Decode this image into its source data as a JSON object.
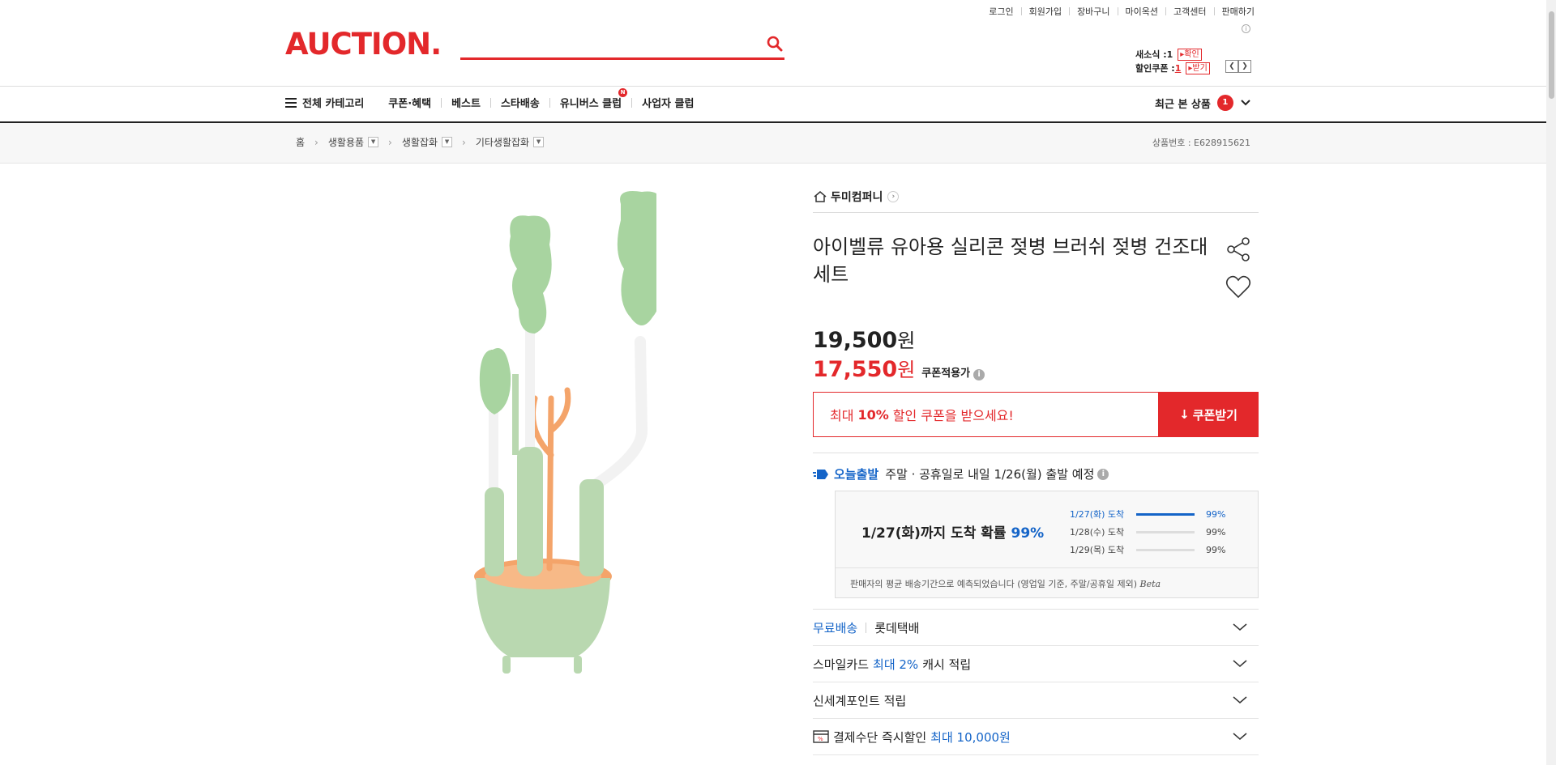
{
  "util_links": [
    "로그인",
    "회원가입",
    "장바구니",
    "마이옥션",
    "고객센터",
    "판매하기"
  ],
  "logo": "AUCTION.",
  "search": {
    "placeholder": "",
    "value": ""
  },
  "mini": {
    "news_label": "새소식 :",
    "news_count": "1",
    "news_btn": "확인",
    "coupon_label": "할인쿠폰 :",
    "coupon_count": "1",
    "coupon_btn": "받기"
  },
  "nav": {
    "all_category": "전체 카테고리",
    "items": [
      "쿠폰·혜택",
      "베스트",
      "스타배송",
      "유니버스 클럽",
      "사업자 클럽"
    ],
    "new_badge": "N",
    "recent_label": "최근 본 상품",
    "recent_count": "1"
  },
  "breadcrumb": [
    "홈",
    "생활용품",
    "생활잡화",
    "기타생활잡화"
  ],
  "product_no": "상품번호 : E628915621",
  "store": "두미컴퍼니",
  "title": "아이벨류 유아용 실리콘 젖병 브러쉬 젖병 건조대 세트",
  "price": {
    "original": "19,500",
    "won": "원",
    "coupon": "17,550",
    "coupon_label": "쿠폰적용가"
  },
  "coupon": {
    "prefix": "최대 ",
    "percent": "10%",
    "suffix": " 할인 쿠폰을 받으세요!",
    "button": "쿠폰받기"
  },
  "today": {
    "badge": "오늘출발",
    "text": "주말 · 공휴일로 내일 1/26(월) 출발 예정"
  },
  "delivery": {
    "headline_prefix": "1/27(화)까지 도착 확률 ",
    "headline_pct": "99%",
    "rows": [
      {
        "date": "1/27(화) 도착",
        "pct": "99%",
        "fill": 1.0
      },
      {
        "date": "1/28(수) 도착",
        "pct": "99%",
        "fill": 0.0
      },
      {
        "date": "1/29(목) 도착",
        "pct": "99%",
        "fill": 0.0
      }
    ],
    "note": "판매자의 평균 배송기간으로 예측되었습니다 (영업일 기준, 주말/공휴일 제외)",
    "beta": "Beta"
  },
  "rows": {
    "shipping_free": "무료배송",
    "shipping_carrier": "롯데택배",
    "smile_prefix": "스마일카드 ",
    "smile_blue": "최대 2%",
    "smile_suffix": " 캐시 적립",
    "shinsegae": "신세계포인트 적립",
    "pay_prefix": "결제수단 즉시할인 ",
    "pay_blue": "최대 10,000원"
  },
  "colors": {
    "accent": "#e3282b",
    "blue": "#1464c8",
    "brush_green": "#a8d4a0",
    "stand_orange": "#f4a46a"
  }
}
